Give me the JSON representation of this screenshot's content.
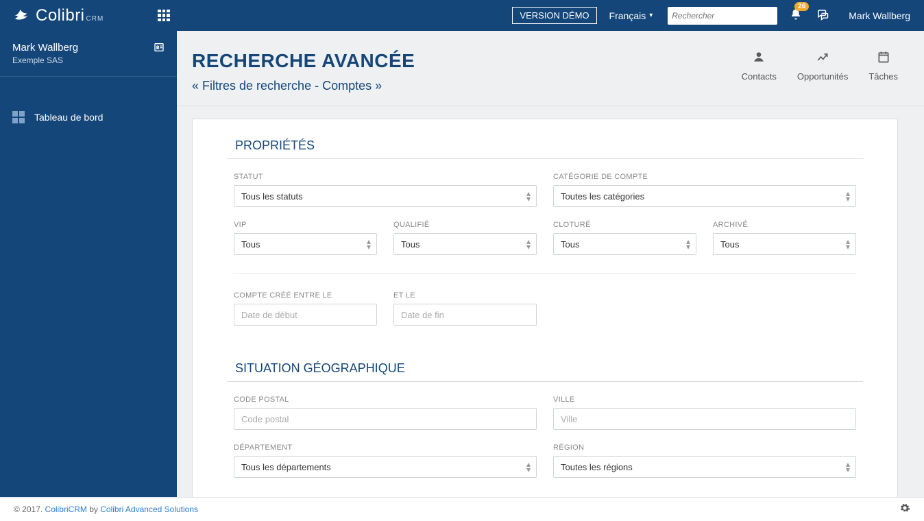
{
  "brand": {
    "name": "Colibri",
    "sub": "CRM"
  },
  "topbar": {
    "version_btn": "VERSION DÉMO",
    "language": "Français",
    "search_placeholder": "Rechercher",
    "notif_count": "26",
    "user": "Mark Wallberg"
  },
  "sidebar": {
    "user_name": "Mark Wallberg",
    "user_company": "Exemple SAS",
    "items": [
      {
        "label": "Tableau de bord"
      }
    ]
  },
  "page": {
    "title": "RECHERCHE AVANCÉE",
    "subtitle": "« Filtres de recherche - Comptes »",
    "quick_links": [
      {
        "label": "Contacts"
      },
      {
        "label": "Opportunités"
      },
      {
        "label": "Tâches"
      }
    ]
  },
  "sections": {
    "properties": {
      "title": "PROPRIÉTÉS",
      "statut": {
        "label": "STATUT",
        "value": "Tous les statuts"
      },
      "categorie": {
        "label": "CATÉGORIE DE COMPTE",
        "value": "Toutes les catégories"
      },
      "vip": {
        "label": "VIP",
        "value": "Tous"
      },
      "qualifie": {
        "label": "QUALIFIÉ",
        "value": "Tous"
      },
      "cloture": {
        "label": "CLOTURÉ",
        "value": "Tous"
      },
      "archive": {
        "label": "ARCHIVÉ",
        "value": "Tous"
      },
      "date_from": {
        "label": "COMPTE CRÉÉ ENTRE LE",
        "placeholder": "Date de début"
      },
      "date_to": {
        "label": "ET LE",
        "placeholder": "Date de fin"
      }
    },
    "geo": {
      "title": "SITUATION GÉOGRAPHIQUE",
      "cp": {
        "label": "CODE POSTAL",
        "placeholder": "Code postal"
      },
      "ville": {
        "label": "VILLE",
        "placeholder": "Ville"
      },
      "dept": {
        "label": "DÉPARTEMENT",
        "value": "Tous les départements"
      },
      "region": {
        "label": "RÉGION",
        "value": "Toutes les régions"
      }
    }
  },
  "footer": {
    "copyright": "© 2017. ",
    "link1": "ColibriCRM",
    "by": " by ",
    "link2": "Colibri Advanced Solutions"
  }
}
